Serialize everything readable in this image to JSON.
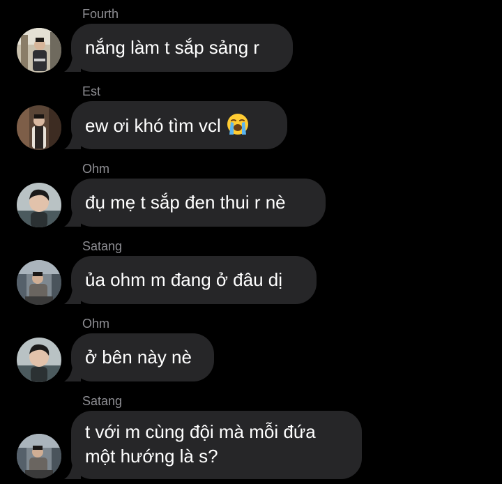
{
  "messages": [
    {
      "sender": "Fourth",
      "text": "nắng làm t sắp sảng r"
    },
    {
      "sender": "Est",
      "text": "ew ơi khó tìm vcl",
      "emoji": "loudly-crying-face-icon"
    },
    {
      "sender": "Ohm",
      "text": "đụ mẹ t sắp đen thui r nè"
    },
    {
      "sender": "Satang",
      "text": "ủa ohm m đang ở đâu dị"
    },
    {
      "sender": "Ohm",
      "text": "ở bên này nè"
    },
    {
      "sender": "Satang",
      "line1": "t với m cùng đội mà mỗi đứa",
      "line2": "một hướng là s?"
    }
  ],
  "colors": {
    "background": "#000000",
    "bubble": "#262628",
    "sender": "#8e8e93",
    "text": "#ffffff"
  }
}
